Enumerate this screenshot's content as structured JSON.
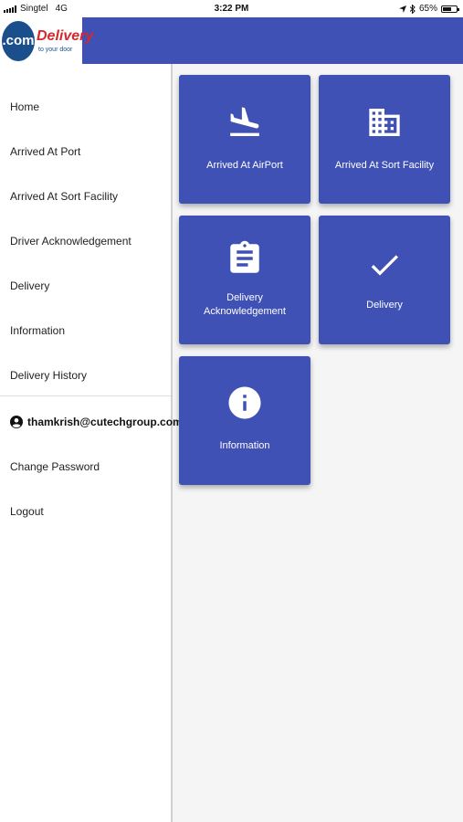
{
  "status_bar": {
    "carrier": "Singtel",
    "network": "4G",
    "time": "3:22 PM",
    "battery": "65%",
    "battery_level": 0.65,
    "icons": [
      "location-arrow-icon",
      "bluetooth-icon"
    ]
  },
  "header": {
    "logo_prefix": ".com",
    "logo_word": "Delivery",
    "logo_tagline": "to your door",
    "accent_color": "#3f51b5"
  },
  "sidebar": {
    "items": [
      {
        "label": "Home"
      },
      {
        "label": "Arrived At Port"
      },
      {
        "label": "Arrived At Sort Facility"
      },
      {
        "label": "Driver Acknowledgement"
      },
      {
        "label": "Delivery"
      },
      {
        "label": "Information"
      },
      {
        "label": "Delivery History"
      }
    ],
    "user_email": "thamkrish@cutechgroup.com",
    "user_icon": "account-circle-icon",
    "account_items": [
      {
        "label": "Change Password"
      },
      {
        "label": "Logout"
      }
    ]
  },
  "tiles": [
    {
      "label": "Arrived At AirPort",
      "icon": "flight-land-icon"
    },
    {
      "label": "Arrived At Sort Facility",
      "icon": "building-icon"
    },
    {
      "label_line1": "Delivery",
      "label_line2": "Acknowledgement",
      "icon": "clipboard-icon"
    },
    {
      "label": "Delivery",
      "icon": "check-icon"
    },
    {
      "label": "Information",
      "icon": "info-icon"
    }
  ]
}
